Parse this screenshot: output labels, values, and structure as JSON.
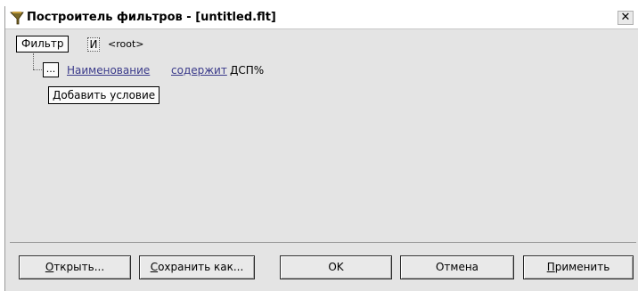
{
  "window": {
    "title": "Построитель фильтров - [untitled.flt]",
    "close_glyph": "✕",
    "icon": "filter-app-icon"
  },
  "tree": {
    "root_button": "Фильтр",
    "root_operator": "И",
    "root_label": "<root>",
    "conditions": [
      {
        "menu_button": "...",
        "field": "Наименование",
        "operator": "содержит",
        "value": "ДСП%"
      }
    ],
    "add_condition_button": "Добавить условие"
  },
  "buttons": {
    "open": {
      "accel": "О",
      "rest": "ткрыть..."
    },
    "save_as": {
      "accel": "С",
      "rest": "охранить как..."
    },
    "ok": "OK",
    "cancel": "Отмена",
    "apply": {
      "accel": "П",
      "rest": "рименить"
    }
  },
  "colors": {
    "window_bg": "#e4e4e4",
    "link_text": "#3a3a8a"
  }
}
